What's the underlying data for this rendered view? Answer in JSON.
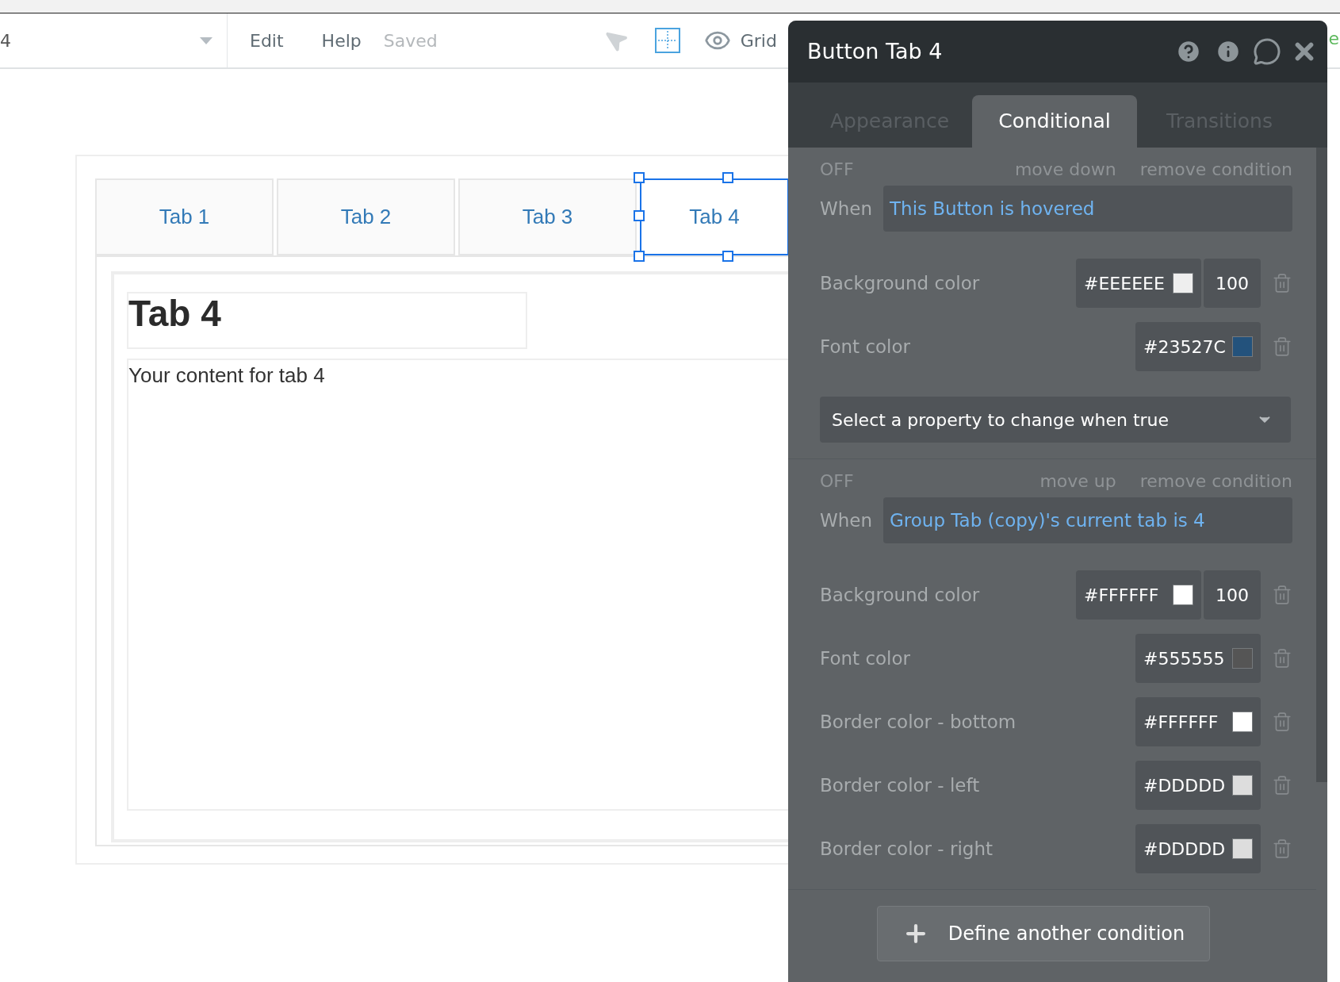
{
  "toolbar": {
    "page_name": "4",
    "menu": [
      "Edit",
      "Help"
    ],
    "status": "Saved",
    "grid_label": "Grid",
    "edge_text": "e"
  },
  "canvas": {
    "tabs": [
      {
        "label": "Tab 1",
        "selected": false
      },
      {
        "label": "Tab 2",
        "selected": false
      },
      {
        "label": "Tab 3",
        "selected": false
      },
      {
        "label": "Tab 4",
        "selected": true
      }
    ],
    "heading": "Tab 4",
    "body": "Your content for tab 4"
  },
  "panel": {
    "title": "Button Tab 4",
    "tabs": [
      {
        "label": "Appearance",
        "selected": false
      },
      {
        "label": "Conditional",
        "selected": true
      },
      {
        "label": "Transitions",
        "selected": false
      }
    ],
    "conditions": [
      {
        "toggle": "OFF",
        "move": "move down",
        "remove": "remove condition",
        "when_label": "When",
        "expression": "This Button is hovered",
        "properties": [
          {
            "label": "Background color",
            "value": "#EEEEEE",
            "color": "#eeeeee",
            "opacity": "100"
          },
          {
            "label": "Font color",
            "value": "#23527C",
            "color": "#23527c"
          }
        ],
        "select_placeholder": "Select a property to change when true"
      },
      {
        "toggle": "OFF",
        "move": "move up",
        "remove": "remove condition",
        "when_label": "When",
        "expression": "Group Tab (copy)'s current tab is 4",
        "properties": [
          {
            "label": "Background color",
            "value": "#FFFFFF",
            "color": "#ffffff",
            "opacity": "100"
          },
          {
            "label": "Font color",
            "value": "#555555",
            "color": "#555555"
          },
          {
            "label": "Border color - bottom",
            "value": "#FFFFFF",
            "color": "#ffffff"
          },
          {
            "label": "Border color - left",
            "value": "#DDDDD",
            "color": "#dddddd"
          },
          {
            "label": "Border color - right",
            "value": "#DDDDD",
            "color": "#dddddd"
          }
        ]
      }
    ],
    "add_button": "Define another condition"
  }
}
